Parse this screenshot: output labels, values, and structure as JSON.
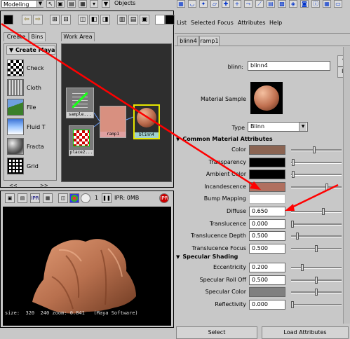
{
  "topbar": {
    "mode": "Modeling",
    "objects_label": "Objects"
  },
  "hypershade": {
    "tabs": [
      "Create",
      "Bins"
    ],
    "work_area_tab": "Work Area",
    "create_menu": "Create Maya",
    "materials": [
      {
        "label": "Check",
        "icon": "checker-icon"
      },
      {
        "label": "Cloth",
        "icon": "cloth-icon"
      },
      {
        "label": "File",
        "icon": "file-texture-icon"
      },
      {
        "label": "Fluid T",
        "icon": "fluid-texture-icon"
      },
      {
        "label": "Fracta",
        "icon": "fractal-icon"
      },
      {
        "label": "Grid",
        "icon": "grid-icon"
      }
    ],
    "nodes": [
      {
        "label": "sample...",
        "icon": "placement-node-icon"
      },
      {
        "label": "place2...",
        "icon": "place2d-node-icon"
      },
      {
        "label": "ramp1",
        "icon": "ramp-node-icon"
      },
      {
        "label": "blinn4",
        "icon": "blinn-sphere-icon"
      }
    ],
    "nav_left": "<<",
    "nav_right": ">>"
  },
  "render_view": {
    "frame_number": "1",
    "ipr_label": "IPR: 0MB",
    "status": "size:  320  240 zoom: 0.841   (Maya Software)"
  },
  "attribute_editor": {
    "menu": [
      "List",
      "Selected",
      "Focus",
      "Attributes",
      "Help"
    ],
    "tabs": [
      "blinn4",
      "ramp1"
    ],
    "name_label": "blinn:",
    "name_value": "blinn4",
    "material_sample_label": "Material Sample",
    "type_label": "Type",
    "type_value": "Blinn",
    "common_section": "Common Material Attributes",
    "common_attrs": [
      {
        "label": "Color",
        "kind": "color",
        "color": "#8b6452",
        "slider": 0.45
      },
      {
        "label": "Transparency",
        "kind": "color",
        "color": "#000000",
        "slider": 0.02
      },
      {
        "label": "Ambient Color",
        "kind": "color",
        "color": "#000000",
        "slider": 0.02
      },
      {
        "label": "Incandescence",
        "kind": "color",
        "color": "#b07060",
        "slider": 0.72
      },
      {
        "label": "Bump Mapping",
        "kind": "empty"
      },
      {
        "label": "Diffuse",
        "kind": "value",
        "value": "0.650",
        "slider": 0.65
      },
      {
        "label": "Translucence",
        "kind": "value",
        "value": "0.000",
        "slider": 0.0
      },
      {
        "label": "Translucence Depth",
        "kind": "value",
        "value": "0.500",
        "slider": 0.1
      },
      {
        "label": "Translucence Focus",
        "kind": "value",
        "value": "0.500",
        "slider": 0.5
      }
    ],
    "specular_section": "Specular Shading",
    "specular_attrs": [
      {
        "label": "Eccentricity",
        "kind": "value",
        "value": "0.200",
        "slider": 0.2
      },
      {
        "label": "Specular Roll Off",
        "kind": "value",
        "value": "0.500",
        "slider": 0.5
      },
      {
        "label": "Specular Color",
        "kind": "color",
        "color": "#808080",
        "slider": 0.5
      },
      {
        "label": "Reflectivity",
        "kind": "value",
        "value": "0.000",
        "slider": 0.0
      }
    ],
    "buttons": {
      "select": "Select",
      "load_attributes": "Load Attributes"
    }
  },
  "colors": {
    "annotation_arrow": "#ff0000",
    "skin": "#c88462",
    "highlight_blue": "#1a4fd0"
  }
}
